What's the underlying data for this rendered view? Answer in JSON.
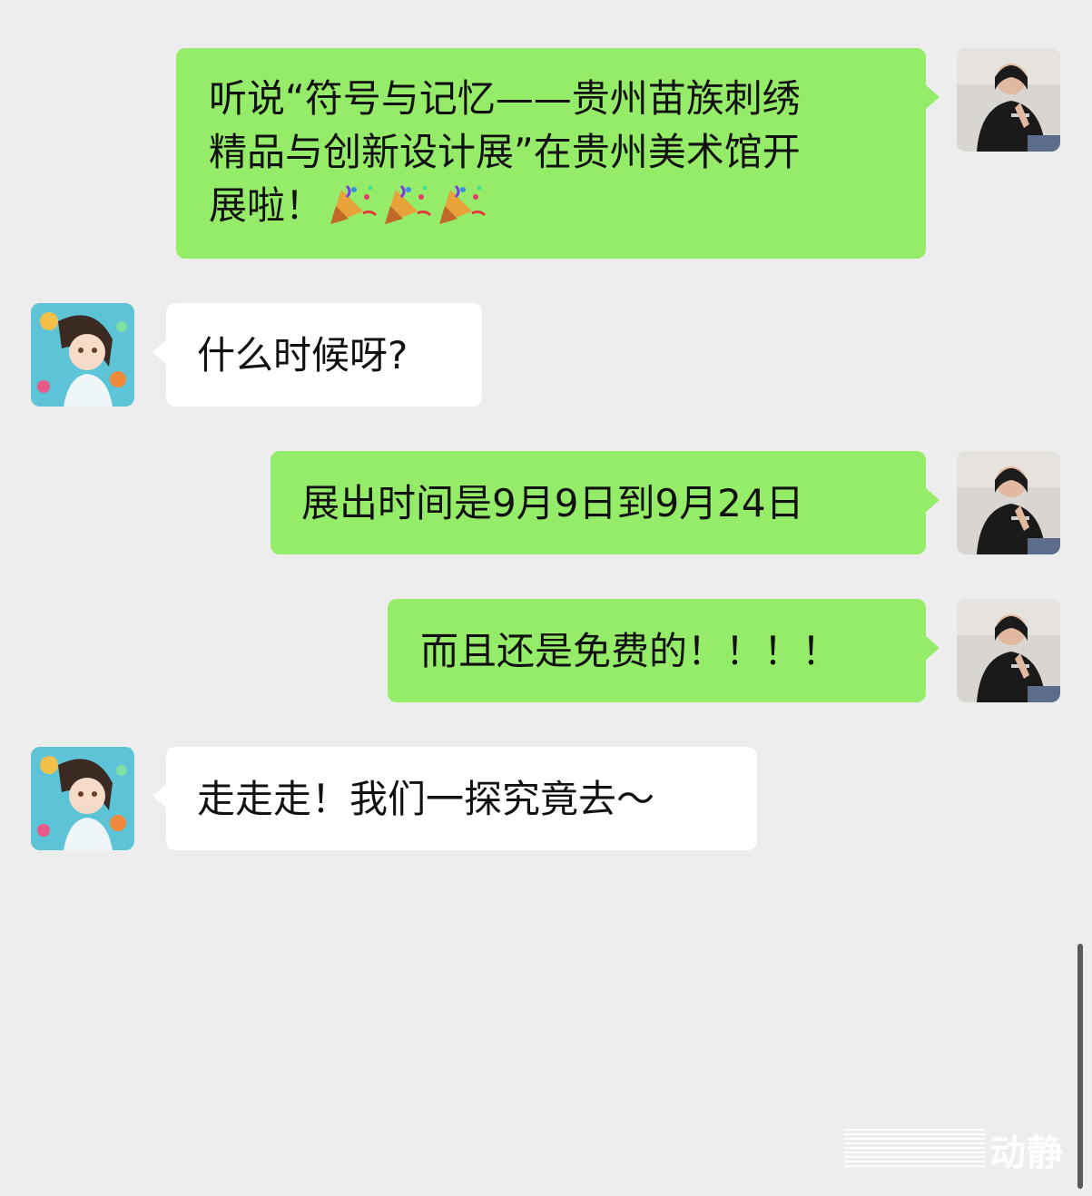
{
  "chat": {
    "messages": [
      {
        "sender": "me",
        "text_lines": [
          "听说“符号与记忆——贵州苗族刺绣",
          "精品与创新设计展”在贵州美术馆开",
          "展啦！"
        ],
        "emojis": [
          "party-popper-icon",
          "party-popper-icon",
          "party-popper-icon"
        ]
      },
      {
        "sender": "them",
        "text": "什么时候呀?"
      },
      {
        "sender": "me",
        "text": "展出时间是9月9日到9月24日"
      },
      {
        "sender": "me",
        "text": "而且还是免费的！！！！"
      },
      {
        "sender": "them",
        "text": "走走走！我们一探究竟去～"
      }
    ]
  },
  "watermark": {
    "text": "动静"
  },
  "colors": {
    "background": "#ededed",
    "my_bubble": "#95ec69",
    "their_bubble": "#ffffff"
  }
}
